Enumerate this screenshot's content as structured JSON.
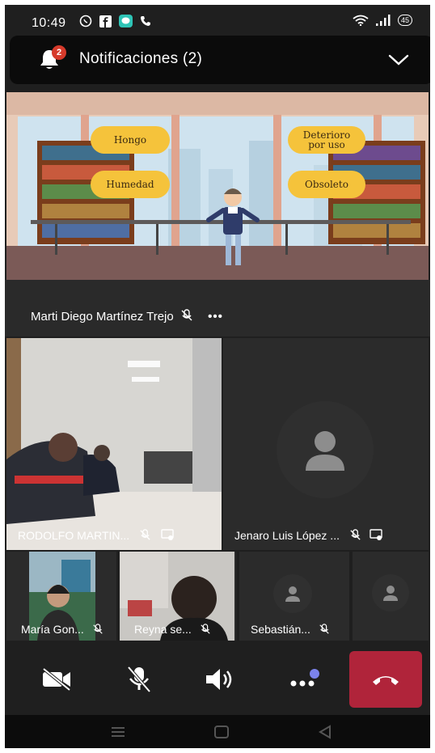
{
  "status_bar": {
    "time": "10:49",
    "battery": "45",
    "icons": [
      "whatsapp-icon",
      "facebook-icon",
      "chat-icon",
      "phone-icon",
      "wifi-icon",
      "signal-icon",
      "battery-icon"
    ]
  },
  "notifications": {
    "title": "Notificaciones (2)",
    "badge_count": "2"
  },
  "shared_content": {
    "labels": [
      "Hongo",
      "Humedad",
      "Deterioro por uso",
      "Obsoleto"
    ],
    "colors": {
      "bubble": "#f5c33b",
      "floor": "#7b5a57",
      "wall": "#e4c8b6"
    }
  },
  "presenter": {
    "name": "Marti Diego Martínez Trejo",
    "more": "•••"
  },
  "participants": [
    {
      "name": "RODOLFO MARTIN..."
    },
    {
      "name": "Jenaro Luis López ..."
    },
    {
      "name": "María Gon..."
    },
    {
      "name": "Reyna se..."
    },
    {
      "name": "Sebastián..."
    }
  ],
  "controls": {
    "accent": "#b0243a",
    "icons": [
      "video-off-icon",
      "mic-off-icon",
      "speaker-icon",
      "more-icon",
      "hangup-icon"
    ]
  }
}
